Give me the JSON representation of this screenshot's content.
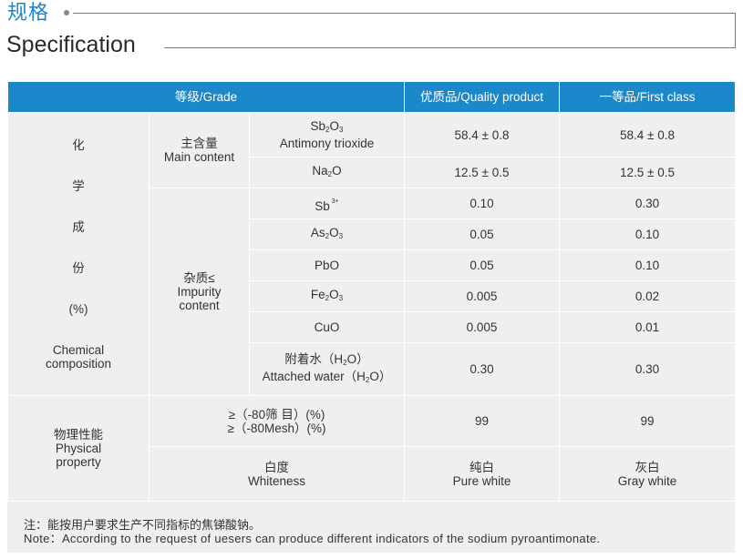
{
  "header": {
    "title_cn": "规格",
    "title_en": "Specification"
  },
  "table": {
    "col_headers": {
      "grade": "等级/Grade",
      "quality": "优质品/Quality product",
      "first": "一等品/First class"
    },
    "chem": {
      "label_chars": [
        "化",
        "学",
        "成",
        "份",
        "(%)"
      ],
      "label_en": [
        "Chemical",
        "composition"
      ],
      "main_content": {
        "cn": "主含量",
        "en": "Main content",
        "rows": [
          {
            "formula_main": [
              "Sb",
              "2",
              "O",
              "3"
            ],
            "name_en": "Antimony trioxide",
            "quality": "58.4 ± 0.8",
            "first": "58.4 ± 0.8"
          },
          {
            "formula": [
              "Na",
              "2",
              "O"
            ],
            "quality": "12.5 ± 0.5",
            "first": "12.5 ± 0.5"
          }
        ]
      },
      "impurity": {
        "cn": "杂质≤",
        "en": [
          "Impurity",
          "content"
        ],
        "rows": [
          {
            "item": "Sb",
            "sup": "3+",
            "quality": "0.10",
            "first": "0.30"
          },
          {
            "item": "As",
            "sub": "2",
            "tail": "O",
            "sub2": "3",
            "quality": "0.05",
            "first": "0.10"
          },
          {
            "item": "PbO",
            "quality": "0.05",
            "first": "0.10"
          },
          {
            "item": "Fe",
            "sub": "2",
            "tail": "O",
            "sub2": "3",
            "quality": "0.005",
            "first": "0.02"
          },
          {
            "item": "CuO",
            "quality": "0.005",
            "first": "0.01"
          }
        ],
        "water": {
          "cn_pre": "附着水（H",
          "cn_sub": "2",
          "cn_post": "O）",
          "en_pre": "Attached water（H",
          "en_sub": "2",
          "en_post": "O）",
          "quality": "0.30",
          "first": "0.30"
        }
      }
    },
    "physical": {
      "cn": "物理性能",
      "en": [
        "Physical",
        "property"
      ],
      "mesh": {
        "line1": "≥（-80筛  目）(%)",
        "line2": "≥（-80Mesh）(%)",
        "quality": "99",
        "first": "99"
      },
      "whiteness": {
        "cn": "白度",
        "en": "Whiteness",
        "quality_cn": "纯白",
        "quality_en": "Pure white",
        "first_cn": "灰白",
        "first_en": "Gray white"
      }
    }
  },
  "note": {
    "cn": "注：能按用户要求生产不同指标的焦锑酸钠。",
    "en": "Note：According to the request of uesers can produce different indicators of the sodium pyroantimonate."
  }
}
